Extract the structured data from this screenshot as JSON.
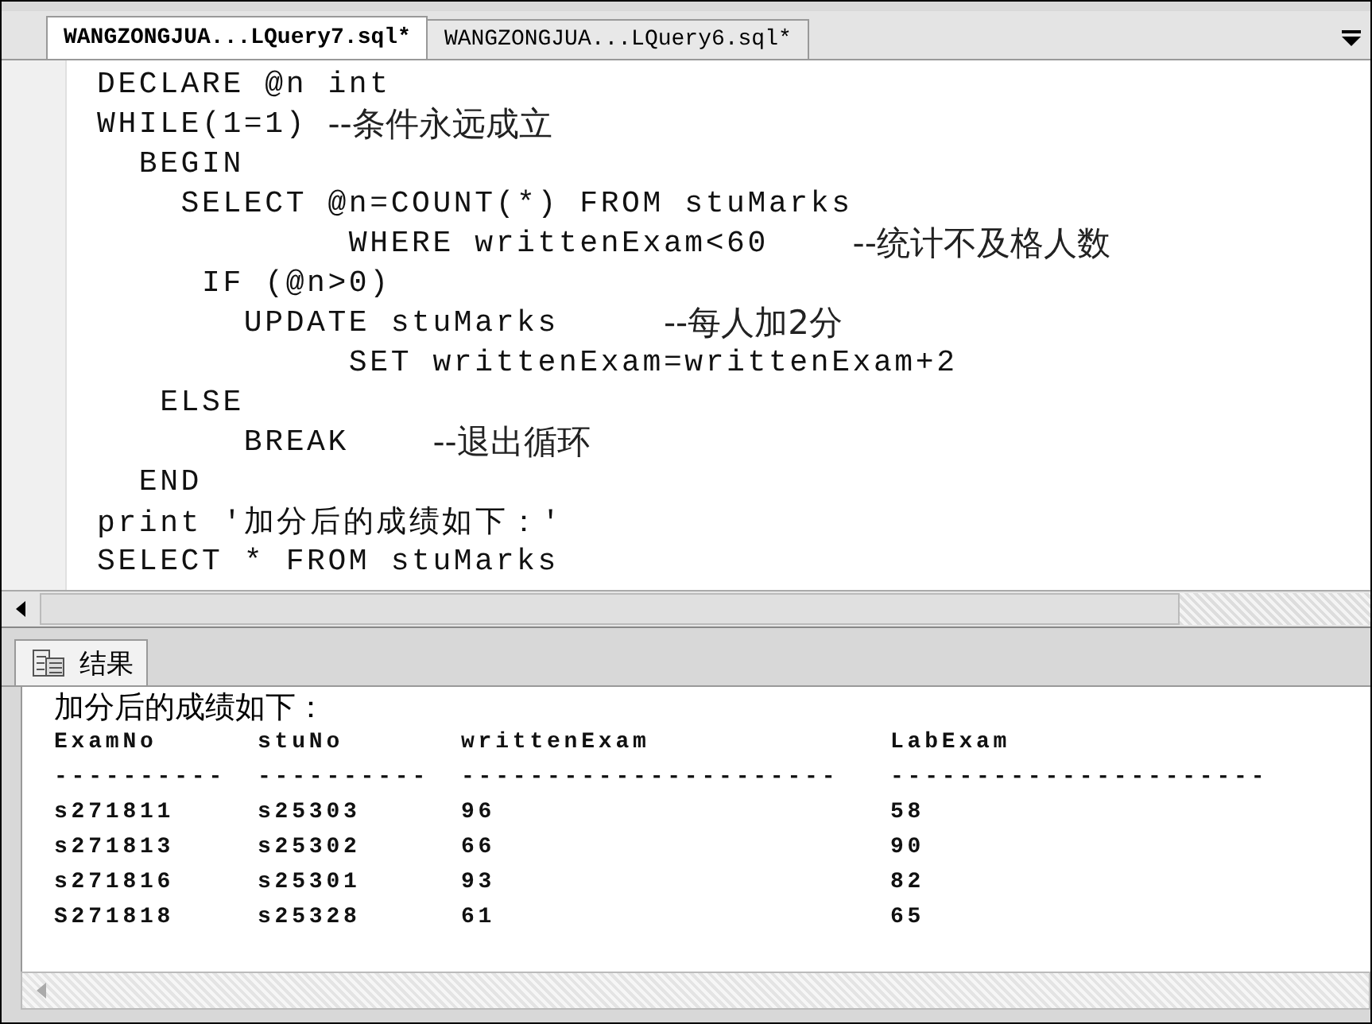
{
  "tabs": [
    {
      "label": "WANGZONGJUA...LQuery7.sql*",
      "selected": true
    },
    {
      "label": "WANGZONGJUA...LQuery6.sql*",
      "selected": false
    }
  ],
  "editor": {
    "lines": [
      {
        "code": "DECLARE @n int"
      },
      {
        "code": "WHILE(1=1) ",
        "comment": "--条件永远成立"
      },
      {
        "code": "  BEGIN"
      },
      {
        "code": "    SELECT @n=COUNT(*) FROM stuMarks"
      },
      {
        "code": "            WHERE writtenExam<60    ",
        "comment": "--统计不及格人数"
      },
      {
        "code": "     IF (@n>0)"
      },
      {
        "code": "       UPDATE stuMarks     ",
        "comment": "--每人加2分"
      },
      {
        "code": "            SET writtenExam=writtenExam+2"
      },
      {
        "code": "   ELSE"
      },
      {
        "code": "       BREAK    ",
        "comment": "--退出循环"
      },
      {
        "code": "  END"
      },
      {
        "code": "print '加分后的成绩如下：'"
      },
      {
        "code": "SELECT * FROM stuMarks"
      }
    ]
  },
  "results": {
    "tab": {
      "label": "结果",
      "selected": true
    },
    "message": "加分后的成绩如下：",
    "columns": [
      {
        "name": "ExamNo",
        "rule": "----------"
      },
      {
        "name": "stuNo",
        "rule": "----------"
      },
      {
        "name": "writtenExam",
        "rule": "----------------------"
      },
      {
        "name": "LabExam",
        "rule": "----------------------"
      }
    ],
    "rows": [
      [
        "s271811",
        "s25303",
        "96",
        "58"
      ],
      [
        "s271813",
        "s25302",
        "66",
        "90"
      ],
      [
        "s271816",
        "s25301",
        "93",
        "82"
      ],
      [
        "S271818",
        "s25328",
        "61",
        "65"
      ]
    ]
  }
}
